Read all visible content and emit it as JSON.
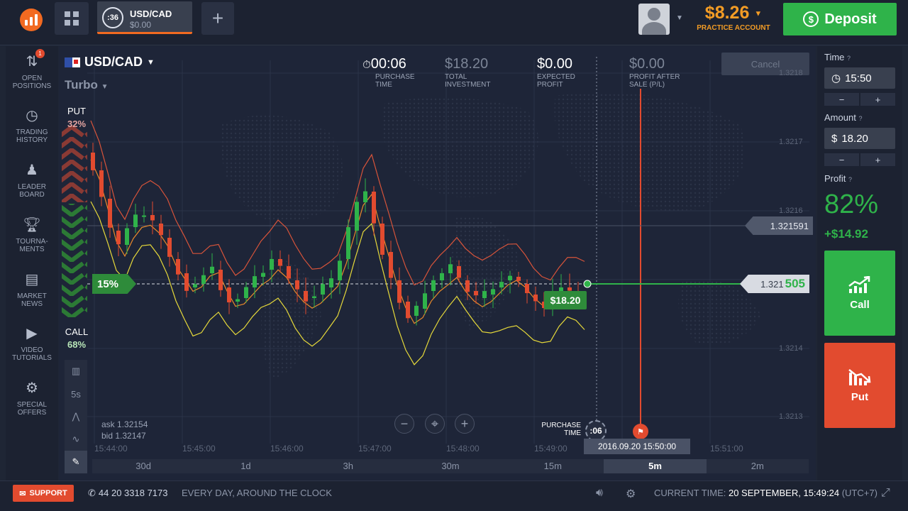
{
  "topbar": {
    "asset_tab": {
      "timer": ":36",
      "name": "USD/CAD",
      "value": "$0.00"
    },
    "balance": "$8.26",
    "account_type": "PRACTICE ACCOUNT",
    "deposit_label": "Deposit"
  },
  "sidebar": {
    "items": [
      {
        "label": "OPEN POSITIONS",
        "badge": "1",
        "icon": "arrows-icon"
      },
      {
        "label": "TRADING HISTORY",
        "icon": "history-icon"
      },
      {
        "label": "LEADER BOARD",
        "icon": "leader-icon"
      },
      {
        "label": "TOURNA- MENTS",
        "icon": "trophy-icon"
      },
      {
        "label": "MARKET NEWS",
        "icon": "news-icon"
      },
      {
        "label": "VIDEO TUTORIALS",
        "icon": "play-icon"
      },
      {
        "label": "SPECIAL OFFERS",
        "icon": "gear-icon"
      }
    ]
  },
  "chart": {
    "pair": "USD/CAD",
    "mode": "Turbo",
    "purchase_time": {
      "value": "00:06",
      "label": "PURCHASE TIME"
    },
    "total_investment": {
      "value": "$18.20",
      "label": "TOTAL INVESTMENT"
    },
    "expected_profit": {
      "value": "$0.00",
      "label": "EXPECTED PROFIT"
    },
    "profit_after_sale": {
      "value": "$0.00",
      "label": "PROFIT AFTER SALE (P/L)"
    },
    "cancel_label": "Cancel",
    "put": {
      "label": "PUT",
      "pct": "32%"
    },
    "call": {
      "label": "CALL",
      "pct": "68%"
    },
    "marker_pct": "15%",
    "current_price_prefix": "1.321",
    "current_price_suffix": "505",
    "previous_price": "1.321591",
    "investment_tag": "$18.20",
    "y_ticks": [
      "1.3218",
      "1.3217",
      "1.3216",
      "1.3214",
      "1.3213"
    ],
    "x_ticks": [
      "15:44:00",
      "15:45:00",
      "15:46:00",
      "15:47:00",
      "15:48:00",
      "15:49:00",
      "15:51:00"
    ],
    "ask": "ask 1.32154",
    "bid": "bid 1.32147",
    "tool_interval": "5s",
    "purchase_time_label": "PURCHASE TIME",
    "purchase_countdown": ":06",
    "expiry_time": "2016.09.20 15:50:00",
    "timeframes": [
      "30d",
      "1d",
      "3h",
      "30m",
      "15m",
      "5m",
      "2m"
    ],
    "active_timeframe": "5m"
  },
  "right_panel": {
    "time_label": "Time",
    "time_value": "15:50",
    "amount_label": "Amount",
    "amount_currency": "$",
    "amount_value": "18.20",
    "profit_label": "Profit",
    "profit_pct": "82%",
    "profit_amount": "+$14.92",
    "call_label": "Call",
    "put_label": "Put",
    "minus": "−",
    "plus": "+"
  },
  "bottom": {
    "support_label": "SUPPORT",
    "phone": "44 20 3318 7173",
    "hours": "EVERY DAY, AROUND THE CLOCK",
    "current_time_label": "CURRENT TIME:",
    "current_time_value": "20 SEPTEMBER, 15:49:24",
    "timezone": "(UTC+7)"
  },
  "colors": {
    "accent": "#f26a21",
    "call": "#2fb34a",
    "put": "#e24b2f",
    "balance": "#f39c25"
  }
}
